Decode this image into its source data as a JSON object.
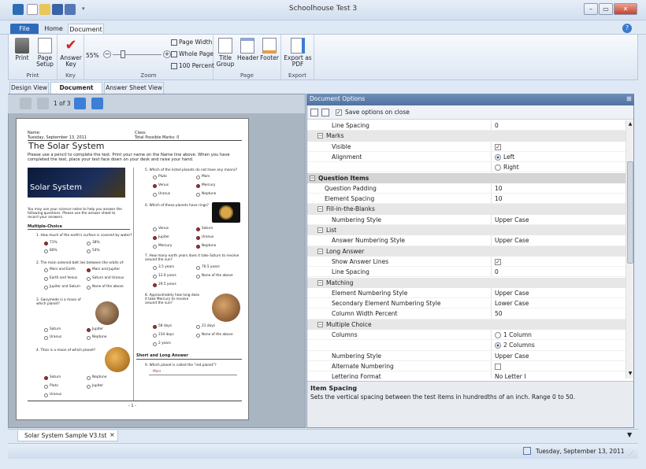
{
  "window": {
    "title": "Schoolhouse Test 3"
  },
  "ribbon_tabs": [
    "File",
    "Home",
    "Document"
  ],
  "ribbon": {
    "print": {
      "print": "Print",
      "page_setup": "Page Setup",
      "group": "Print"
    },
    "key": {
      "answer_key": "Answer Key",
      "group": "Key"
    },
    "zoom": {
      "percent": "55%",
      "value": 0.55,
      "page_width": "Page Width",
      "whole_page": "Whole Page",
      "hundred": "100 Percent",
      "group": "Zoom"
    },
    "page": {
      "title_group": "Title Group",
      "header": "Header",
      "footer": "Footer",
      "group": "Page"
    },
    "export": {
      "export_pdf": "Export as PDF",
      "group": "Export"
    }
  },
  "view_tabs": [
    "Design View",
    "Document View",
    "Answer Sheet View"
  ],
  "pager": {
    "label": "1 of 3"
  },
  "doc": {
    "name_label": "Name:",
    "date": "Tuesday, September 13, 2011",
    "class_label": "Class:",
    "marks": "Total Possible Marks: 0",
    "title": "The Solar System",
    "instructions": "Please use a pencil to complete the test. Print your name on the Name line above. When you have completed the test, place your test face down on your desk and raise your hand.",
    "banner": "Solar System",
    "intro": "You may use your science notes to help you answer the following questions. Please use the answer sheet to record your answers.",
    "mc_heading": "Multiple-Choice",
    "q1": "1. How much of the earth's surface is covered by water?",
    "q1_opts": [
      "71%",
      "38%",
      "80%",
      "54%"
    ],
    "q2": "2. The main asteroid belt lies between the orbits of:",
    "q2_opts": [
      "Mars and Earth",
      "Mars and Jupiter",
      "Earth and Venus",
      "Saturn and Uranus",
      "Jupiter and Saturn",
      "None of the above"
    ],
    "q3": "3. Ganymede is a moon of which planet?",
    "q3_opts": [
      "Saturn",
      "Jupiter",
      "Uranus",
      "Neptune"
    ],
    "q4": "4. Titan is a moon of which planet?",
    "q4_opts": [
      "Saturn",
      "Neptune",
      "Pluto",
      "Jupiter",
      "Uranus"
    ],
    "q5": "5. Which of the listed planets do not have any moons?",
    "q5_opts": [
      "Pluto",
      "Mars",
      "Venus",
      "Mercury",
      "Uranus",
      "Neptune"
    ],
    "q6": "6. Which of these planets have rings?",
    "q6_opts": [
      "Venus",
      "Saturn",
      "Jupiter",
      "Uranus",
      "Mercury",
      "Neptune"
    ],
    "q7": "7. How many earth years does it take Saturn to revolve around the sun?",
    "q7_opts": [
      "3.5 years",
      "76.5 years",
      "12.6 years",
      "None of the above",
      "29.5 years"
    ],
    "q8": "8. Approximately how long does it take Mercury to revolve around the sun?",
    "q8_opts": [
      "58 days",
      "21 days",
      "234 days",
      "None of the above",
      "2 years"
    ],
    "sla_heading": "Short and Long Answer",
    "q9": "9. Which planet is called the \"red planet\"?",
    "q9_ans": "Mars",
    "footer": "- 1 -"
  },
  "options": {
    "header": "Document Options",
    "save_on_close": "Save options on close",
    "save_checked": true,
    "rows": [
      {
        "type": "prop",
        "indent": 2,
        "name": "Line Spacing",
        "value": "0"
      },
      {
        "type": "cat",
        "indent": 1,
        "name": "Marks"
      },
      {
        "type": "prop",
        "indent": 2,
        "name": "Visible",
        "check": true
      },
      {
        "type": "prop",
        "indent": 2,
        "name": "Alignment",
        "radio": "Left",
        "radio_on": true
      },
      {
        "type": "prop",
        "indent": 2,
        "name": "",
        "radio": "Right",
        "radio_on": false
      },
      {
        "type": "top",
        "indent": 0,
        "name": "Question Items"
      },
      {
        "type": "prop",
        "indent": 1,
        "name": "Question Padding",
        "value": "10"
      },
      {
        "type": "prop",
        "indent": 1,
        "name": "Element Spacing",
        "value": "10"
      },
      {
        "type": "cat",
        "indent": 1,
        "name": "Fill-in-the-Blanks"
      },
      {
        "type": "prop",
        "indent": 2,
        "name": "Numbering Style",
        "value": "Upper Case"
      },
      {
        "type": "cat",
        "indent": 1,
        "name": "List"
      },
      {
        "type": "prop",
        "indent": 2,
        "name": "Answer Numbering Style",
        "value": "Upper Case"
      },
      {
        "type": "cat",
        "indent": 1,
        "name": "Long Answer"
      },
      {
        "type": "prop",
        "indent": 2,
        "name": "Show Answer Lines",
        "check": true
      },
      {
        "type": "prop",
        "indent": 2,
        "name": "Line Spacing",
        "value": "0"
      },
      {
        "type": "cat",
        "indent": 1,
        "name": "Matching"
      },
      {
        "type": "prop",
        "indent": 2,
        "name": "Element Numbering Style",
        "value": "Upper Case"
      },
      {
        "type": "prop",
        "indent": 2,
        "name": "Secondary Element Numbering Style",
        "value": "Lower Case"
      },
      {
        "type": "prop",
        "indent": 2,
        "name": "Column Width Percent",
        "value": "50"
      },
      {
        "type": "cat",
        "indent": 1,
        "name": "Multiple Choice"
      },
      {
        "type": "prop",
        "indent": 2,
        "name": "Columns",
        "radio": "1 Column",
        "radio_on": false
      },
      {
        "type": "prop",
        "indent": 2,
        "name": "",
        "radio": "2 Columns",
        "radio_on": true
      },
      {
        "type": "prop",
        "indent": 2,
        "name": "Numbering Style",
        "value": "Upper Case"
      },
      {
        "type": "prop",
        "indent": 2,
        "name": "Alternate Numbering",
        "check": false
      },
      {
        "type": "prop",
        "indent": 2,
        "name": "Lettering Format",
        "value": "No Letter I"
      }
    ],
    "desc_title": "Item Spacing",
    "desc_text": "Sets the vertical spacing between the test items in hundredths of an inch. Range 0 to 50."
  },
  "doc_tab": {
    "label": "Solar System Sample V3.tst",
    "close": "×"
  },
  "status": {
    "date": "Tuesday, September 13, 2011"
  }
}
